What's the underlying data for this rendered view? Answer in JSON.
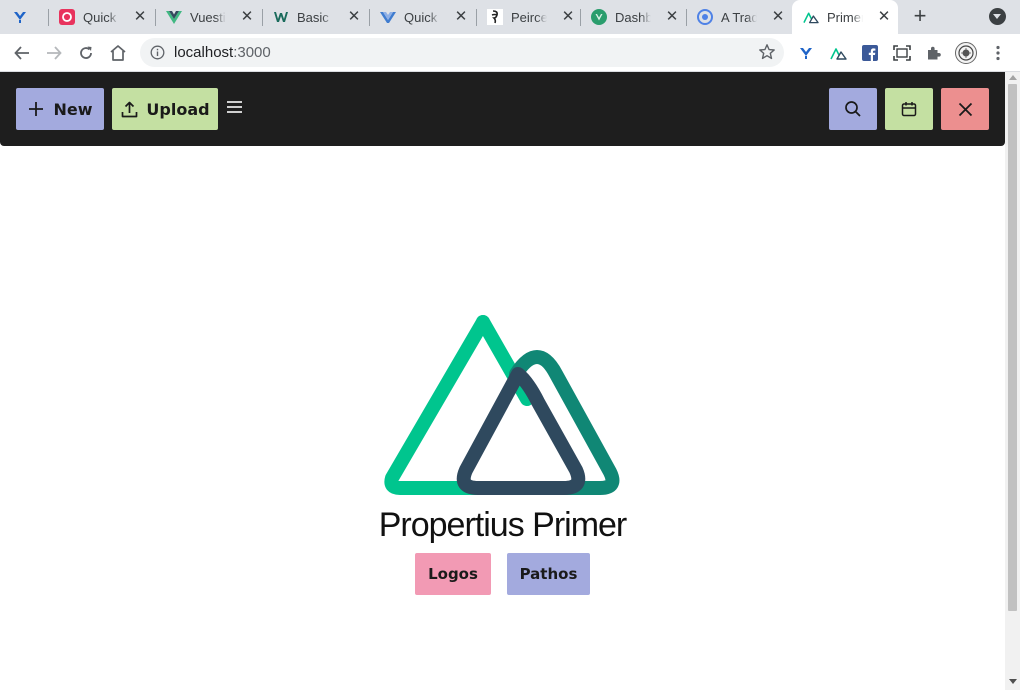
{
  "browser": {
    "tabs": [
      {
        "title": "",
        "icon": "vuestic-y-icon"
      },
      {
        "title": "Quick S",
        "icon": "quasar-q-icon"
      },
      {
        "title": "Vuestic",
        "icon": "vue-icon"
      },
      {
        "title": "Basic C",
        "icon": "vuetify-w-icon"
      },
      {
        "title": "Quick S",
        "icon": "vite-icon"
      },
      {
        "title": "Peirce's",
        "icon": "figure-icon"
      },
      {
        "title": "Dashbo",
        "icon": "vue-circle-icon"
      },
      {
        "title": "A Trade",
        "icon": "chrome-circle-icon"
      },
      {
        "title": "Primer",
        "icon": "nuxt-icon",
        "active": true
      }
    ],
    "address": {
      "host": "localhost",
      "port": ":3000"
    }
  },
  "app": {
    "toolbar": {
      "new_label": "New",
      "upload_label": "Upload"
    },
    "brand_name": "Propertius Primer",
    "buttons": {
      "logos_label": "Logos",
      "pathos_label": "Pathos"
    }
  },
  "colors": {
    "new_button": "#a3aade",
    "upload_button": "#c4e0a2",
    "search_button": "#a3aade",
    "calendar_button": "#c4e0a2",
    "close_button": "#ec8f8f",
    "logos_button": "#f29ab4",
    "pathos_button": "#a3aade",
    "logo_green": "#00c58e",
    "logo_teal": "#108775",
    "logo_dark": "#2f495e"
  }
}
